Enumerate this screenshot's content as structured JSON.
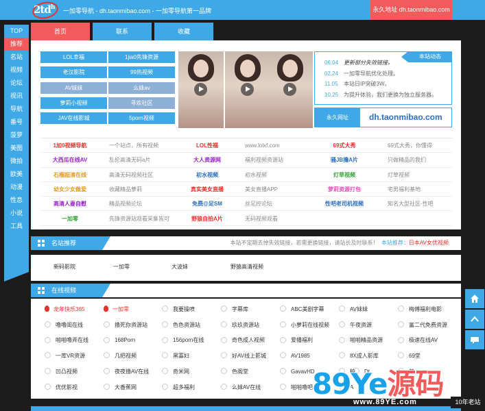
{
  "topbar": {
    "logo_text": "2td",
    "logo_sup": "h",
    "slogan": "一加零导航 - dh.taonmibao.com - 一加零导航第一品牌",
    "permanent": "永久地址 dh.taonmibao.com"
  },
  "leftnav": [
    "TOP",
    "推荐",
    "名站",
    "视频",
    "论坛",
    "视讯",
    "导航",
    "番号",
    "菠萝",
    "美图",
    "微拍",
    "欧美",
    "动漫",
    "性息",
    "小说",
    "工具"
  ],
  "tabs": [
    "首页",
    "联系",
    "收藏"
  ],
  "category_buttons": [
    "LOL幸福",
    "1jia0先锋资源",
    "老汉影院",
    "99热视频",
    "AV妹妹",
    "么妹av",
    "萝莉小视频",
    "寻欢社区",
    "JAV在线影城",
    "5porn视频"
  ],
  "news": {
    "tag": "本站动态",
    "items": [
      {
        "date": "06.04",
        "text": "更新部分失效链接。",
        "highlight": true
      },
      {
        "date": "02.24",
        "text": "一加零导航优化处理。",
        "highlight": false
      },
      {
        "date": "11.05",
        "text": "本站日IP突破3W。",
        "highlight": false
      },
      {
        "date": "10.25",
        "text": "为提升体验，我们更换为独立服务器。",
        "highlight": false
      }
    ]
  },
  "perm_box": {
    "label": "永久网址",
    "url": "dh.taonmibao.com"
  },
  "link_table": [
    [
      {
        "name": "1加0视频导航",
        "color": "#e8322d",
        "desc": "一个站点，所有视频"
      },
      {
        "name": "LOL性福",
        "color": "#e8322d",
        "desc": "www.lolxf.com"
      },
      {
        "name": "69式大秀",
        "color": "#e8322d",
        "desc": "69式大秀，你懂得"
      }
    ],
    [
      {
        "name": "大西瓜在线AV",
        "color": "#9b22c9",
        "desc": "乱伦高清无码a片"
      },
      {
        "name": "大人资源网",
        "color": "#9b22c9",
        "desc": "福利视频资源站"
      },
      {
        "name": "骚JB撸A片",
        "color": "#2a6fc4",
        "desc": "只做精品的我们"
      }
    ],
    [
      {
        "name": "石榴超清在线",
        "color": "#e39a1c",
        "desc": "高清无码视频社区"
      },
      {
        "name": "初水视频",
        "color": "#2a6fc4",
        "desc": "初水视频"
      },
      {
        "name": "灯草视频",
        "color": "#3aa33a",
        "desc": "灯草视频"
      }
    ],
    [
      {
        "name": "幼女少女做爱",
        "color": "#e39a1c",
        "desc": "收藏精品萝莉"
      },
      {
        "name": "真实美女直播",
        "color": "#e8322d",
        "desc": "美女直播APP"
      },
      {
        "name": "萝莉资源打包",
        "color": "#e853b8",
        "desc": "宅男福利基地"
      }
    ],
    [
      {
        "name": "高清人妻自慰",
        "color": "#9b22c9",
        "desc": "精品视频论坛"
      },
      {
        "name": "免费@足SM",
        "color": "#2a6fc4",
        "desc": "丝足控论坛"
      },
      {
        "name": "性吧老司机视频",
        "color": "#2a6fc4",
        "desc": "知名大型社区-性吧"
      }
    ],
    [
      {
        "name": "一加零",
        "color": "#3aa33a",
        "desc": "先锋资源站观看采集皆可"
      },
      {
        "name": "野狼自拍A片",
        "color": "#e8322d",
        "desc": "无码视频观看"
      }
    ]
  ],
  "recommend": {
    "title": "名站推荐",
    "note": "本站不定期去掉失效链接，若需更换链接，请站长及时联系！",
    "note_label": "本站推荐：",
    "note_highlight": "日本AV女优视频",
    "items": [
      "新码影院",
      "一加零",
      "大波妹",
      "野猿高清视频"
    ]
  },
  "online": {
    "title": "在线视频",
    "rows": [
      [
        "龙年快乐365",
        "一加零",
        "我要操喷",
        "字幕库",
        "ABC美剧字幕",
        "AV妹妹",
        "梅傅福利电影"
      ],
      [
        "噜噜闺在线",
        "撸死你资源站",
        "色色资源站",
        "玖玖资源站",
        "小萝莉在线视频",
        "午夜资源",
        "富二代免费资源"
      ],
      [
        "啪啪噜弄在线",
        "168Porn",
        "156porn在线",
        "奇色成人视频",
        "爱播福利",
        "啪啪精品资源",
        "极速在线AV"
      ],
      [
        "一库VR资源",
        "几把视频",
        "黑寡妇",
        "好AV线上影城",
        "AV1985",
        "8X成人影库",
        "69堂"
      ],
      [
        "凹凸视频",
        "夜夜撸AV在线",
        "奇米网",
        "色阁堂",
        "GavavHD",
        "精",
        "Dt",
        "基"
      ],
      [
        "优优影视",
        "大香蕉网",
        "超多福利",
        "么妹AV在线",
        "啪啪噜吧",
        "A",
        "",
        ""
      ]
    ]
  },
  "watermark": {
    "big_a": "89Ye",
    "big_b": "源码",
    "url": "www.89YE.com",
    "badge": "10年老站"
  },
  "float_buttons": [
    "home-icon",
    "chevron-up-icon",
    "chat-icon"
  ],
  "colors": {
    "accent": "#3fa9e8",
    "red": "#f15b5b"
  }
}
